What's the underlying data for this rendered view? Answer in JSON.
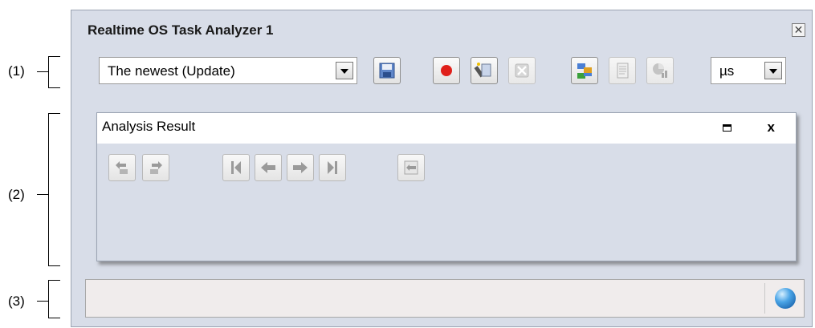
{
  "annotations": {
    "label1": "(1)",
    "label2": "(2)",
    "label3": "(3)"
  },
  "window": {
    "title": "Realtime OS Task Analyzer 1",
    "close_glyph": "✕"
  },
  "toolbar": {
    "mode_select": {
      "value": "The newest (Update)"
    },
    "buttons": [
      {
        "name": "save-icon",
        "enabled": true
      },
      {
        "name": "record-icon",
        "enabled": true
      },
      {
        "name": "clear-icon",
        "enabled": true
      },
      {
        "name": "cancel-icon",
        "enabled": false
      },
      {
        "name": "display-settings-icon",
        "enabled": true
      },
      {
        "name": "report-icon",
        "enabled": false
      },
      {
        "name": "chart-icon",
        "enabled": false
      }
    ],
    "unit_select": {
      "value": "µs"
    }
  },
  "panel": {
    "title": "Analysis Result",
    "close_glyph": "x",
    "buttons": [
      "back-icon",
      "forward-icon",
      "first-icon",
      "previous-icon",
      "next-icon",
      "last-icon",
      "sync-icon"
    ]
  },
  "colors": {
    "window_bg": "#d8dde8",
    "status_bg": "#f0ecec",
    "record_red": "#e0201a",
    "save_blue": "#5f86c8"
  }
}
